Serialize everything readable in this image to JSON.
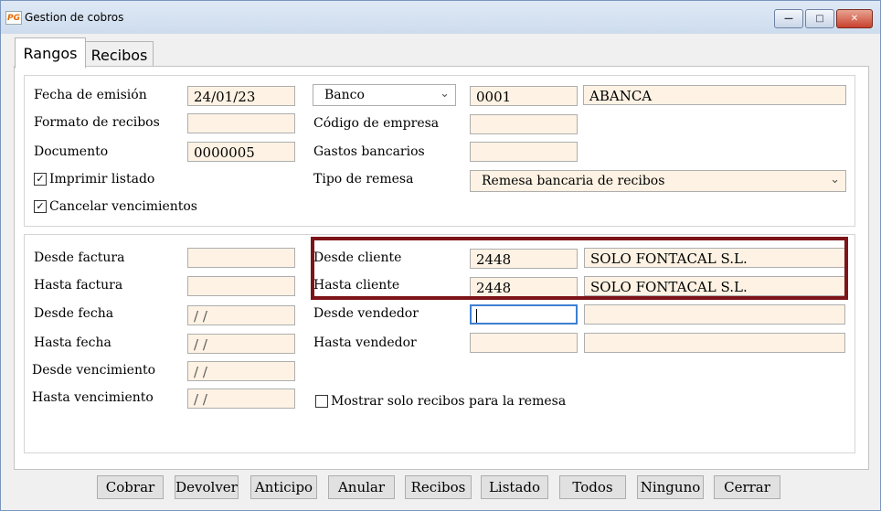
{
  "window": {
    "title": "Gestion de cobros",
    "app_icon_text": "PG",
    "min_glyph": "—",
    "max_glyph": "□",
    "close_glyph": "✕"
  },
  "tabs": [
    {
      "label": "Rangos",
      "active": true
    },
    {
      "label": "Recibos",
      "active": false
    }
  ],
  "emision": {
    "fecha_label": "Fecha de emisión",
    "fecha_value": "24/01/23",
    "formato_label": "Formato de recibos",
    "formato_value": "",
    "documento_label": "Documento",
    "documento_value": "0000005",
    "imprimir_label": "Imprimir listado",
    "imprimir_checked": true,
    "cancelar_label": "Cancelar vencimientos",
    "cancelar_checked": true,
    "check_glyph": "✓"
  },
  "banco": {
    "select_value": "Banco",
    "code": "0001",
    "name": "ABANCA",
    "codigo_empresa_label": "Código de empresa",
    "codigo_empresa_value": "",
    "gastos_label": "Gastos bancarios",
    "gastos_value": "",
    "tipo_remesa_label": "Tipo de remesa",
    "tipo_remesa_value": "Remesa bancaria de recibos",
    "arrow_glyph": "⌄"
  },
  "rangos": {
    "desde_factura_label": "Desde factura",
    "desde_factura_value": "",
    "hasta_factura_label": "Hasta factura",
    "hasta_factura_value": "",
    "desde_fecha_label": "Desde fecha",
    "desde_fecha_value": " / /",
    "hasta_fecha_label": "Hasta fecha",
    "hasta_fecha_value": " / /",
    "desde_venc_label": "Desde vencimiento",
    "desde_venc_value": " / /",
    "hasta_venc_label": "Hasta vencimiento",
    "hasta_venc_value": " / /",
    "desde_cliente_label": "Desde cliente",
    "desde_cliente_code": "2448",
    "desde_cliente_name": "SOLO FONTACAL S.L.",
    "hasta_cliente_label": "Hasta cliente",
    "hasta_cliente_code": "2448",
    "hasta_cliente_name": "SOLO FONTACAL S.L.",
    "desde_vendedor_label": "Desde vendedor",
    "desde_vendedor_code": "",
    "desde_vendedor_name": "",
    "hasta_vendedor_label": "Hasta vendedor",
    "hasta_vendedor_code": "",
    "hasta_vendedor_name": "",
    "mostrar_label": "Mostrar solo recibos para la remesa",
    "mostrar_checked": false
  },
  "buttons": {
    "cobrar": "Cobrar",
    "devolver": "Devolver",
    "anticipo": "Anticipo",
    "anular": "Anular",
    "recibos": "Recibos",
    "listado": "Listado",
    "todos": "Todos",
    "ninguno": "Ninguno",
    "cerrar": "Cerrar"
  },
  "colors": {
    "highlight": "#7d1419",
    "field_bg": "#fdf2e3",
    "focus": "#3d7fd1"
  }
}
